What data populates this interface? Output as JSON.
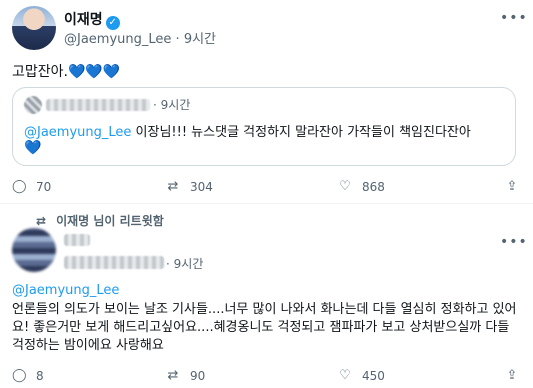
{
  "tweet1": {
    "display_name": "이재명",
    "handle": "@Jaemyung_Lee",
    "dot": "·",
    "time": "9시간",
    "text": "고맙잔아.",
    "hearts": "💙💙💙",
    "quote": {
      "time": "9시간",
      "mention": "@Jaemyung_Lee",
      "text": " 이장님!!! 뉴스댓글 걱정하지 말라잔아 가작들이 책임진다잔아",
      "heart": "💙"
    },
    "stats": {
      "replies": "70",
      "retweets": "304",
      "likes": "868"
    }
  },
  "tweet2": {
    "retweeted_by": "이재명 님이 리트윗함",
    "time": "9시간",
    "mention": "@Jaemyung_Lee",
    "body": "언론들의 의도가 보이는 날조 기사들....너무 많이 나와서 화나는데 다들 열심히 정화하고 있어요! 좋은거만 보게 해드리고싶어요....혜경옹니도 걱정되고 잼파파가 보고 상처받으실까 다들 걱정하는 밤이에요 사랑해요",
    "stats": {
      "replies": "8",
      "retweets": "90",
      "likes": "450"
    }
  },
  "icons": {
    "more": "more-icon",
    "reply": "reply-icon",
    "retweet": "retweet-icon",
    "like": "heart-icon",
    "share": "share-icon",
    "verified": "verified-icon"
  },
  "colors": {
    "accent": "#1d9bf0",
    "secondary_text": "#536471",
    "heart_emoji": "#7cc0f5"
  }
}
